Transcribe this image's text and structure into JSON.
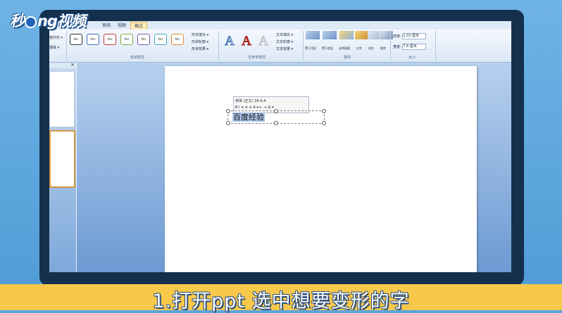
{
  "logo": {
    "text_before": "秒",
    "text_mid": "ng",
    "text_after": "视频"
  },
  "ribbon": {
    "tabs": [
      "审阅",
      "视图",
      "格式"
    ],
    "active_tab": "格式",
    "left_partial": [
      "镜外形 ▾",
      "填域 ▾"
    ],
    "shape_styles": {
      "thumbs": [
        "Abc",
        "Abc",
        "Abc",
        "Abc",
        "Abc",
        "Abc",
        "Abc"
      ],
      "commands": [
        "形状填充 ▾",
        "形状轮廓 ▾",
        "形状效果 ▾"
      ],
      "label": "形状样式"
    },
    "wordart": {
      "letters": [
        "A",
        "A",
        "A"
      ],
      "commands": [
        "文本填充 ▾",
        "文本轮廓 ▾",
        "文本效果 ▾"
      ],
      "label": "艺术字样式"
    },
    "arrange": {
      "buttons": [
        "置于顶层",
        "置于底层",
        "选择窗格",
        "对齐",
        "组合",
        "旋转"
      ],
      "label": "排列"
    },
    "size": {
      "height_label": "高度:",
      "height_value": "1.03 厘米",
      "width_label": "宽度:",
      "width_value": "7.8 厘米",
      "label": "大小"
    }
  },
  "mini_toolbar": {
    "font": "宋体 (正文)",
    "size": "18",
    "row2": "B I ≡ ≡ ≡ A ▾ ⇤ ⇥ ☰ ▾"
  },
  "textbox": {
    "content": "百度经验"
  },
  "panel": {
    "close": "×"
  },
  "caption": {
    "text": "1.打开ppt 选中想要变形的字"
  },
  "colors": {
    "background": "#5aa6de",
    "caption_bar": "#f8c84a",
    "active_tab": "#fde9b8"
  }
}
